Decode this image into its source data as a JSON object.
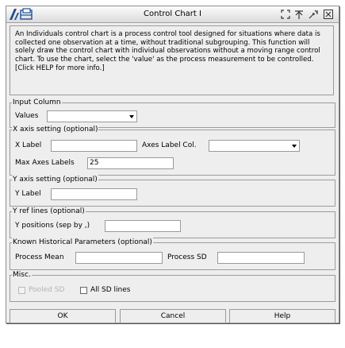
{
  "window": {
    "title": "Control Chart I"
  },
  "description": "An Individuals control chart is a process control tool designed for situations where data is collected one observation at a time, without traditional subgrouping. This function will solely draw the control chart with individual observations without a moving range control chart. To use the chart, select the 'value' as the process measurement to be controlled. [Click HELP for more info.]",
  "input_column": {
    "legend": "Input Column",
    "values_label": "Values",
    "values_selected": ""
  },
  "x_axis": {
    "legend": "X axis setting (optional)",
    "x_label": "X Label",
    "x_label_value": "",
    "axes_label_col": "Axes Label Col.",
    "axes_label_col_value": "",
    "max_axes_labels": "Max Axes Labels",
    "max_axes_labels_value": "25"
  },
  "y_axis": {
    "legend": "Y axis setting (optional)",
    "y_label": "Y Label",
    "y_label_value": ""
  },
  "y_ref": {
    "legend": "Y ref lines (optional)",
    "positions_label": "Y positions (sep by ,)",
    "positions_value": ""
  },
  "known_params": {
    "legend": "Known Historical Parameters (optional)",
    "process_mean": "Process Mean",
    "process_mean_value": "",
    "process_sd": "Process SD",
    "process_sd_value": ""
  },
  "misc": {
    "legend": "Misc.",
    "pooled_sd": "Pooled SD",
    "all_sd_lines": "All SD lines"
  },
  "buttons": {
    "ok": "OK",
    "cancel": "Cancel",
    "help": "Help"
  },
  "icons": {
    "app": "chart-logo-icon",
    "maximize": "maximize-icon",
    "pin": "pin-icon",
    "resize": "resize-icon",
    "close": "close-icon"
  },
  "colors": {
    "logo_blue": "#1d4f96",
    "window_bg": "#eeeeee"
  }
}
